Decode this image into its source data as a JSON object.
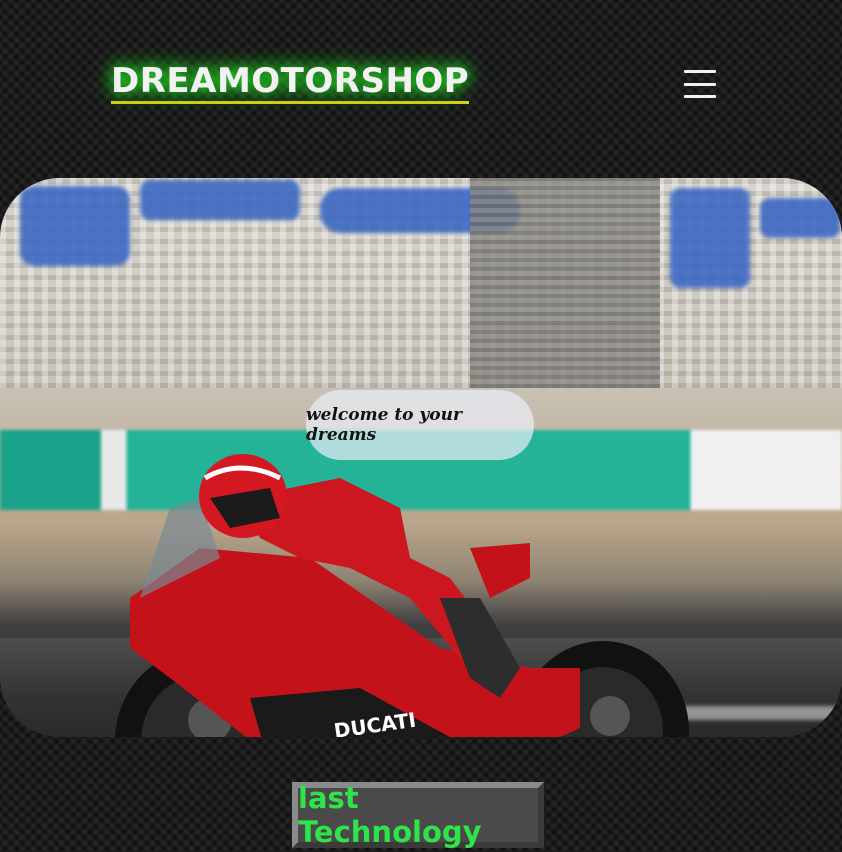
{
  "header": {
    "brand": "DREAMOTORSHOP",
    "menu_icon": "hamburger-menu-icon",
    "brand_glow_color": "#2bff2b",
    "brand_underline_color": "#e0d010"
  },
  "hero": {
    "welcome_text": "welcome to your dreams",
    "image_subject": "red motorcycle on race track",
    "bike_brand_text": "DUCATI"
  },
  "cta": {
    "label": "last Technology",
    "text_color": "#2fe34a"
  }
}
